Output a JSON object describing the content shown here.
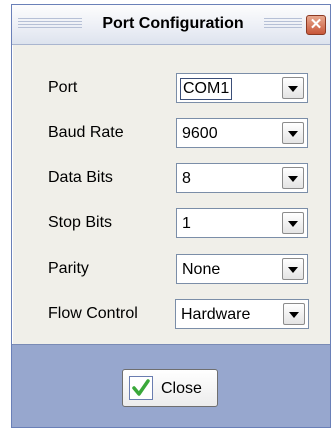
{
  "window": {
    "title": "Port Configuration",
    "close_glyph": "✕"
  },
  "fields": [
    {
      "label": "Port",
      "value": "COM1",
      "selected": true
    },
    {
      "label": "Baud Rate",
      "value": "9600"
    },
    {
      "label": "Data Bits",
      "value": "8"
    },
    {
      "label": "Stop Bits",
      "value": "1"
    },
    {
      "label": "Parity",
      "value": "None"
    },
    {
      "label": "Flow Control",
      "value": "Hardware"
    }
  ],
  "footer": {
    "close_label": "Close",
    "close_icon": "check-icon"
  },
  "colors": {
    "footer_bg": "#97a7ce",
    "dialog_bg": "#f0efe9",
    "check_green": "#3aa83a"
  }
}
